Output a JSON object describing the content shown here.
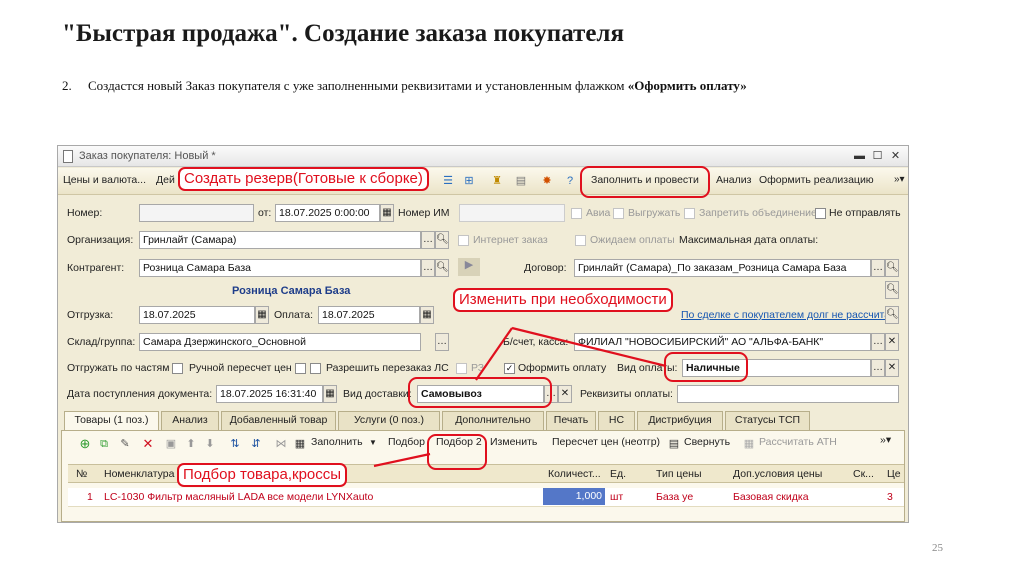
{
  "slide": {
    "title": "\"Быстрая продажа\". Создание заказа покупателя",
    "step_number": "2.",
    "step_text": "Создастся новый Заказ покупателя с уже заполненными реквизитами и установленным флажком ",
    "step_flag": "«Оформить оплату»",
    "page_number": "25"
  },
  "window": {
    "title": "Заказ покупателя: Новый *",
    "toolbar": {
      "prices": "Цены и валюта...",
      "actions": "Дей",
      "fill_post": "Заполнить и провести",
      "analysis": "Анализ",
      "create_sale": "Оформить реализацию"
    },
    "form": {
      "number_label": "Номер:",
      "number_value": "",
      "from_label": "от:",
      "date_value": "18.07.2025  0:00:00",
      "im_number_label": "Номер ИМ",
      "avia": "Авиа",
      "upload": "Выгружать",
      "no_merge": "Запретить объединение",
      "no_send": "Не отправлять",
      "org_label": "Организация:",
      "org_value": "Гринлайт (Самара)",
      "internet_order": "Интернет заказ",
      "awaiting_payment": "Ожидаем оплаты",
      "max_pay_date": "Максимальная дата оплаты:",
      "contractor_label": "Контрагент:",
      "contractor_value": "Розница Самара База",
      "contract_label": "Договор:",
      "contract_value": "Гринлайт (Самара)_По заказам_Розница Самара База",
      "contractor_bold": "Розница Самара База",
      "ship_label": "Отгрузка:",
      "ship_date": "18.07.2025",
      "pay_label": "Оплата:",
      "pay_date": "18.07.2025",
      "debt_link": "По сделке с покупателем долг не рассчитан",
      "warehouse_label": "Склад/группа:",
      "warehouse_value": "Самара Дзержинского_Основной",
      "account_label": "Б/счет, касса:",
      "account_value": "ФИЛИАЛ \"НОВОСИБИРСКИЙ\" АО \"АЛЬФА-БАНК\"",
      "ship_parts": "Отгружать по частям",
      "manual_recalc": "Ручной пересчет цен",
      "allow_reorder": "Разрешить перезаказ ЛС",
      "rz": "РЗ",
      "make_payment": "Оформить оплату",
      "pay_type_label": "Вид оплаты:",
      "pay_type_value": "Наличные",
      "receipt_label": "Дата поступления документа:",
      "receipt_value": "18.07.2025 16:31:40",
      "delivery_label": "Вид доставки:",
      "delivery_value": "Самовывоз",
      "pay_details_label": "Реквизиты оплаты:",
      "pay_details_value": ""
    },
    "tabs": [
      "Товары (1 поз.)",
      "Анализ",
      "Добавленный товар",
      "Услуги (0 поз.)",
      "Дополнительно",
      "Печать",
      "НС",
      "Дистрибуция",
      "Статусы ТСП"
    ],
    "grid_toolbar": {
      "fill": "Заполнить",
      "select": "Подбор",
      "select2": "Подбор 2",
      "change": "Изменить",
      "recalc": "Пересчет цен (неотгр)",
      "collapse": "Свернуть",
      "calc_atn": "Рассчитать АТН"
    },
    "grid": {
      "headers": [
        "№",
        "Номенклатура",
        "Количест...",
        "Ед.",
        "Тип цены",
        "Доп.условия цены",
        "Ск...",
        "Це"
      ],
      "rows": [
        {
          "num": "1",
          "item": "LC-1030 Фильтр масляный LADA все модели LYNXauto",
          "qty": "1,000",
          "unit": "шт",
          "price_type": "База уе",
          "conditions": "Базовая скидка",
          "discount": "",
          "price": "3"
        }
      ]
    }
  },
  "annotations": {
    "reserve": "Создать резерв(Готовые к сборке)",
    "change": "Изменить при необходимости",
    "selection": "Подбор товара,кроссы"
  },
  "colors": {
    "accent_red": "#e0101e",
    "window_bg": "#f1ecd7",
    "selection_blue": "#5477c8",
    "row_text": "#c0001a"
  }
}
